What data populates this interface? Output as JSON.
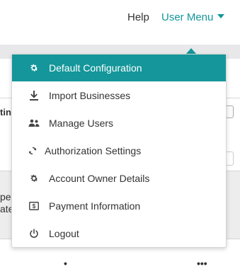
{
  "nav": {
    "help": "Help",
    "user_menu": "User Menu"
  },
  "background": {
    "setting_fragment": "ting",
    "panel_line1": "pen",
    "panel_line2": "ate",
    "bottom_fragment": "•",
    "bottom_fragment2": "•••"
  },
  "menu": {
    "items": [
      {
        "label": "Default Configuration",
        "icon": "gear-icon",
        "active": true
      },
      {
        "label": "Import Businesses",
        "icon": "download-icon",
        "active": false
      },
      {
        "label": "Manage Users",
        "icon": "users-icon",
        "active": false
      },
      {
        "label": "Authorization Settings",
        "icon": "sync-icon",
        "active": false
      },
      {
        "label": "Account Owner Details",
        "icon": "gear-icon",
        "active": false
      },
      {
        "label": "Payment Information",
        "icon": "payment-icon",
        "active": false
      },
      {
        "label": "Logout",
        "icon": "power-icon",
        "active": false
      }
    ]
  },
  "colors": {
    "accent": "#14969a"
  }
}
